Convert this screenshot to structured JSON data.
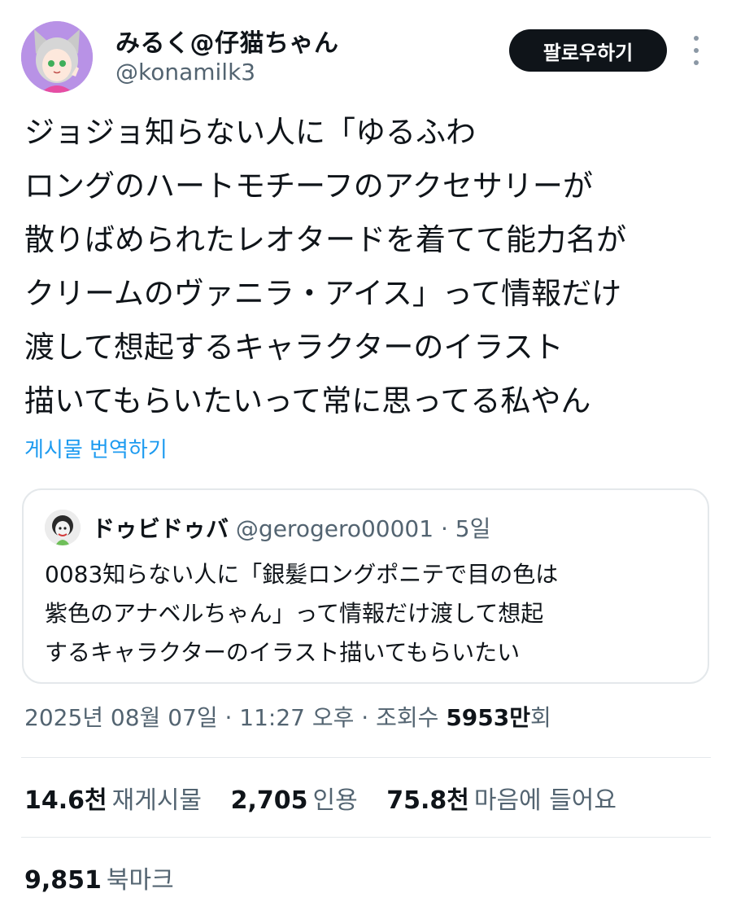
{
  "author": {
    "display_name": "みるく@仔猫ちゃん",
    "handle": "@konamilk3"
  },
  "follow_button": {
    "label": "팔로우하기"
  },
  "tweet": {
    "lines": [
      "ジョジョ知らない人に「ゆるふわ",
      "ロングのハートモチーフのアクセサリーが",
      "散りばめられたレオタードを着てて能力名が",
      "クリームのヴァニラ・アイス」って情報だけ",
      "渡して想起するキャラクターのイラスト",
      "描いてもらいたいって常に思ってる私やん"
    ],
    "translate_label": "게시물 번역하기"
  },
  "quoted_tweet": {
    "display_name": "ドゥビドゥバ",
    "handle": "@gerogero00001",
    "separator": "·",
    "age": "5일",
    "lines": [
      "0083知らない人に「銀髪ロングポニテで目の色は",
      "紫色のアナベルちゃん」って情報だけ渡して想起",
      "するキャラクターのイラスト描いてもらいたい"
    ]
  },
  "meta": {
    "datetime": "2025년 08월 07일 · 11:27 오후 · 조회수",
    "views_number": "5953만",
    "views_suffix": "회"
  },
  "stats": {
    "reposts_count": "14.6천",
    "reposts_label": "재게시물",
    "quotes_count": "2,705",
    "quotes_label": "인용",
    "likes_count": "75.8천",
    "likes_label": "마음에 들어요",
    "bookmarks_count": "9,851",
    "bookmarks_label": "북마크"
  },
  "colors": {
    "accent_link": "#1d9bf0",
    "secondary_text": "#536471",
    "primary_text": "#0f1419",
    "button_bg": "#0f1419",
    "divider": "#e4e8eb",
    "avatar_bg": "#b892e6"
  },
  "icons": {
    "more": "more-vertical-icon"
  }
}
